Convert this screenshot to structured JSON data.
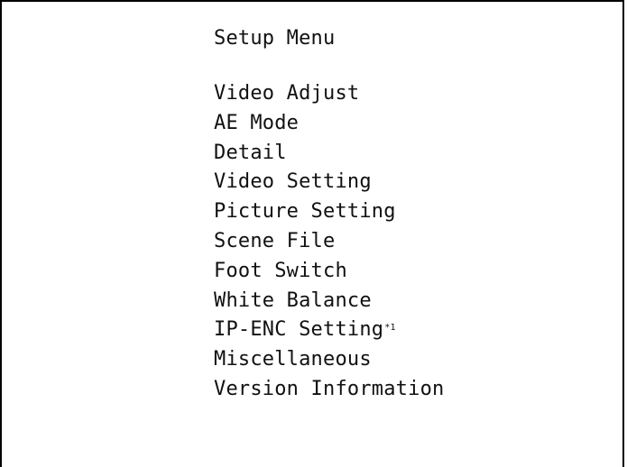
{
  "menu": {
    "title": "Setup Menu",
    "items": [
      {
        "label": "Video Adjust",
        "note": ""
      },
      {
        "label": "AE Mode",
        "note": ""
      },
      {
        "label": "Detail",
        "note": ""
      },
      {
        "label": "Video Setting",
        "note": ""
      },
      {
        "label": "Picture Setting",
        "note": ""
      },
      {
        "label": "Scene File",
        "note": ""
      },
      {
        "label": "Foot Switch",
        "note": ""
      },
      {
        "label": "White Balance",
        "note": ""
      },
      {
        "label": "IP-ENC Setting",
        "note": "*1"
      },
      {
        "label": "Miscellaneous",
        "note": ""
      },
      {
        "label": "Version Information",
        "note": ""
      }
    ]
  }
}
